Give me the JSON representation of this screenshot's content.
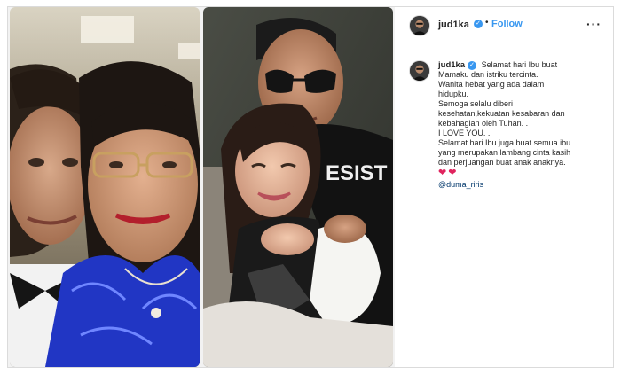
{
  "post": {
    "author": {
      "username": "jud1ka",
      "verified_icon": "verified-badge-icon"
    },
    "header": {
      "separator": "•",
      "follow_label": "Follow",
      "more_label": "···"
    },
    "caption": {
      "lines": [
        "Selamat hari Ibu buat",
        "Mamaku dan istriku tercinta.",
        "Wanita hebat yang ada dalam",
        "hidupku.",
        "Semoga selalu diberi",
        "kesehatan,kekuatan kesabaran dan",
        "kebahagian oleh Tuhan. .",
        "I LOVE YOU. .",
        "Selamat hari Ibu juga buat semua ibu",
        "yang merupakan lambang cinta kasih",
        "dan perjuangan buat anak anaknya."
      ],
      "hearts": [
        "❤",
        "❤"
      ],
      "mention": "@duma_riris"
    },
    "media": {
      "left_photo": "selfie-mother-son",
      "right_photo": "couple-embrace",
      "shirt_text": "ESIST"
    },
    "colors": {
      "accent": "#3897f0",
      "heart": "#e0245e",
      "mention": "#00376b",
      "border": "#dbdbdb"
    }
  }
}
